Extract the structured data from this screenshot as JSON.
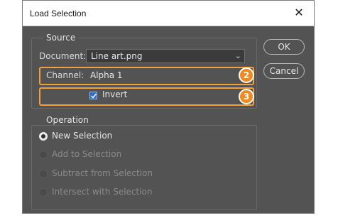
{
  "dialog": {
    "title": "Load Selection"
  },
  "source": {
    "legend": "Source",
    "document_label": "Document:",
    "document_value": "Line art.png",
    "channel_label": "Channel:",
    "channel_value": "Alpha 1",
    "invert_label": "Invert",
    "invert_checked": true
  },
  "operation": {
    "legend": "Operation",
    "options": [
      {
        "label": "New Selection",
        "selected": true,
        "enabled": true
      },
      {
        "label": "Add to Selection",
        "selected": false,
        "enabled": false
      },
      {
        "label": "Subtract from Selection",
        "selected": false,
        "enabled": false
      },
      {
        "label": "Intersect with Selection",
        "selected": false,
        "enabled": false
      }
    ]
  },
  "buttons": {
    "ok": "OK",
    "cancel": "Cancel"
  },
  "callouts": {
    "channel_number": "2",
    "invert_number": "3"
  },
  "colors": {
    "callout_orange": "#f18a1e",
    "dialog_bg": "#535353",
    "checkbox_blue": "#2c6fd0"
  },
  "icons": {
    "close": "close-icon",
    "dropdown": "chevron-down-icon",
    "check": "checkmark-icon"
  }
}
